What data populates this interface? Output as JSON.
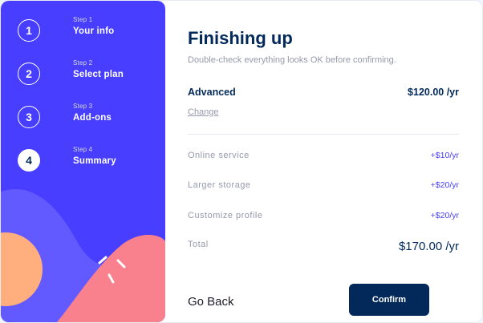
{
  "steps": [
    {
      "number": "1",
      "step_label": "Step 1",
      "name": "Your info"
    },
    {
      "number": "2",
      "step_label": "Step 2",
      "name": "Select plan"
    },
    {
      "number": "3",
      "step_label": "Step 3",
      "name": "Add-ons"
    },
    {
      "number": "4",
      "step_label": "Step 4",
      "name": "Summary"
    }
  ],
  "summary": {
    "title": "Finishing up",
    "subtitle": "Double-check everything looks OK before confirming.",
    "plan_name": "Advanced",
    "plan_price": "$120.00 /yr",
    "change_label": "Change",
    "addons": [
      {
        "name": "Online service",
        "price": "+$10/yr"
      },
      {
        "name": "Larger storage",
        "price": "+$20/yr"
      },
      {
        "name": "Customize profile",
        "price": "+$20/yr"
      }
    ],
    "total_label": "Total",
    "total_price": "$170.00 /yr"
  },
  "actions": {
    "back_label": "Go Back",
    "confirm_label": "Confirm"
  },
  "colors": {
    "sidebar_bg": "#483eff",
    "marine_blue": "#02295a",
    "purplish_blue": "#483eff",
    "cool_gray": "#9699ab",
    "pink_blob": "#f9818e",
    "orange_circle": "#ffaf7e"
  }
}
